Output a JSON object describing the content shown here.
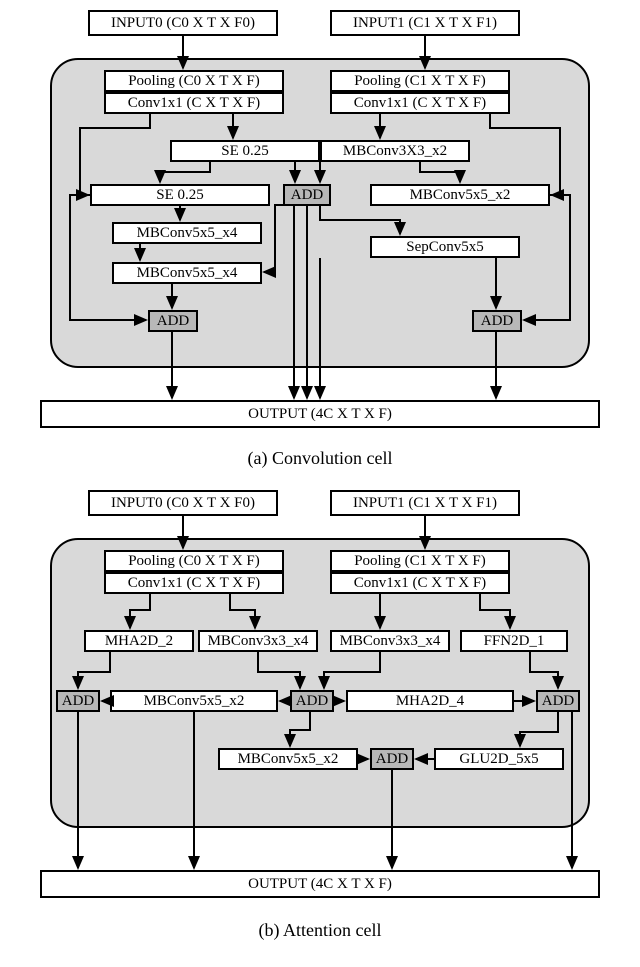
{
  "conv": {
    "input0": "INPUT0 (C0 X T X F0)",
    "input1": "INPUT1 (C1 X T X F1)",
    "pool0": "Pooling (C0 X T X F)",
    "conv0": "Conv1x1 (C X T X F)",
    "pool1": "Pooling (C1 X T X F)",
    "conv1": "Conv1x1 (C X T X F)",
    "se_top": "SE 0.25",
    "mb3x3": "MBConv3X3_x2",
    "se_left": "SE 0.25",
    "add_center": "ADD",
    "mb5x5_r": "MBConv5x5_x2",
    "mb5x5_a": "MBConv5x5_x4",
    "sep5x5": "SepConv5x5",
    "mb5x5_b": "MBConv5x5_x4",
    "add_left": "ADD",
    "add_right": "ADD",
    "output": "OUTPUT (4C X T X F)",
    "caption": "(a) Convolution cell"
  },
  "attn": {
    "input0": "INPUT0 (C0 X T X F0)",
    "input1": "INPUT1 (C1 X T X F1)",
    "pool0": "Pooling (C0 X T X F)",
    "conv0": "Conv1x1 (C X T X F)",
    "pool1": "Pooling (C1 X T X F)",
    "conv1": "Conv1x1 (C X T X F)",
    "mha2d2": "MHA2D_2",
    "mb3x3_a": "MBConv3x3_x4",
    "mb3x3_b": "MBConv3x3_x4",
    "ffn": "FFN2D_1",
    "add_l": "ADD",
    "mb5x5_a": "MBConv5x5_x2",
    "add_c": "ADD",
    "mha2d4": "MHA2D_4",
    "add_r": "ADD",
    "mb5x5_b": "MBConv5x5_x2",
    "add_b": "ADD",
    "glu": "GLU2D_5x5",
    "output": "OUTPUT (4C X T X F)",
    "caption": "(b) Attention cell"
  }
}
